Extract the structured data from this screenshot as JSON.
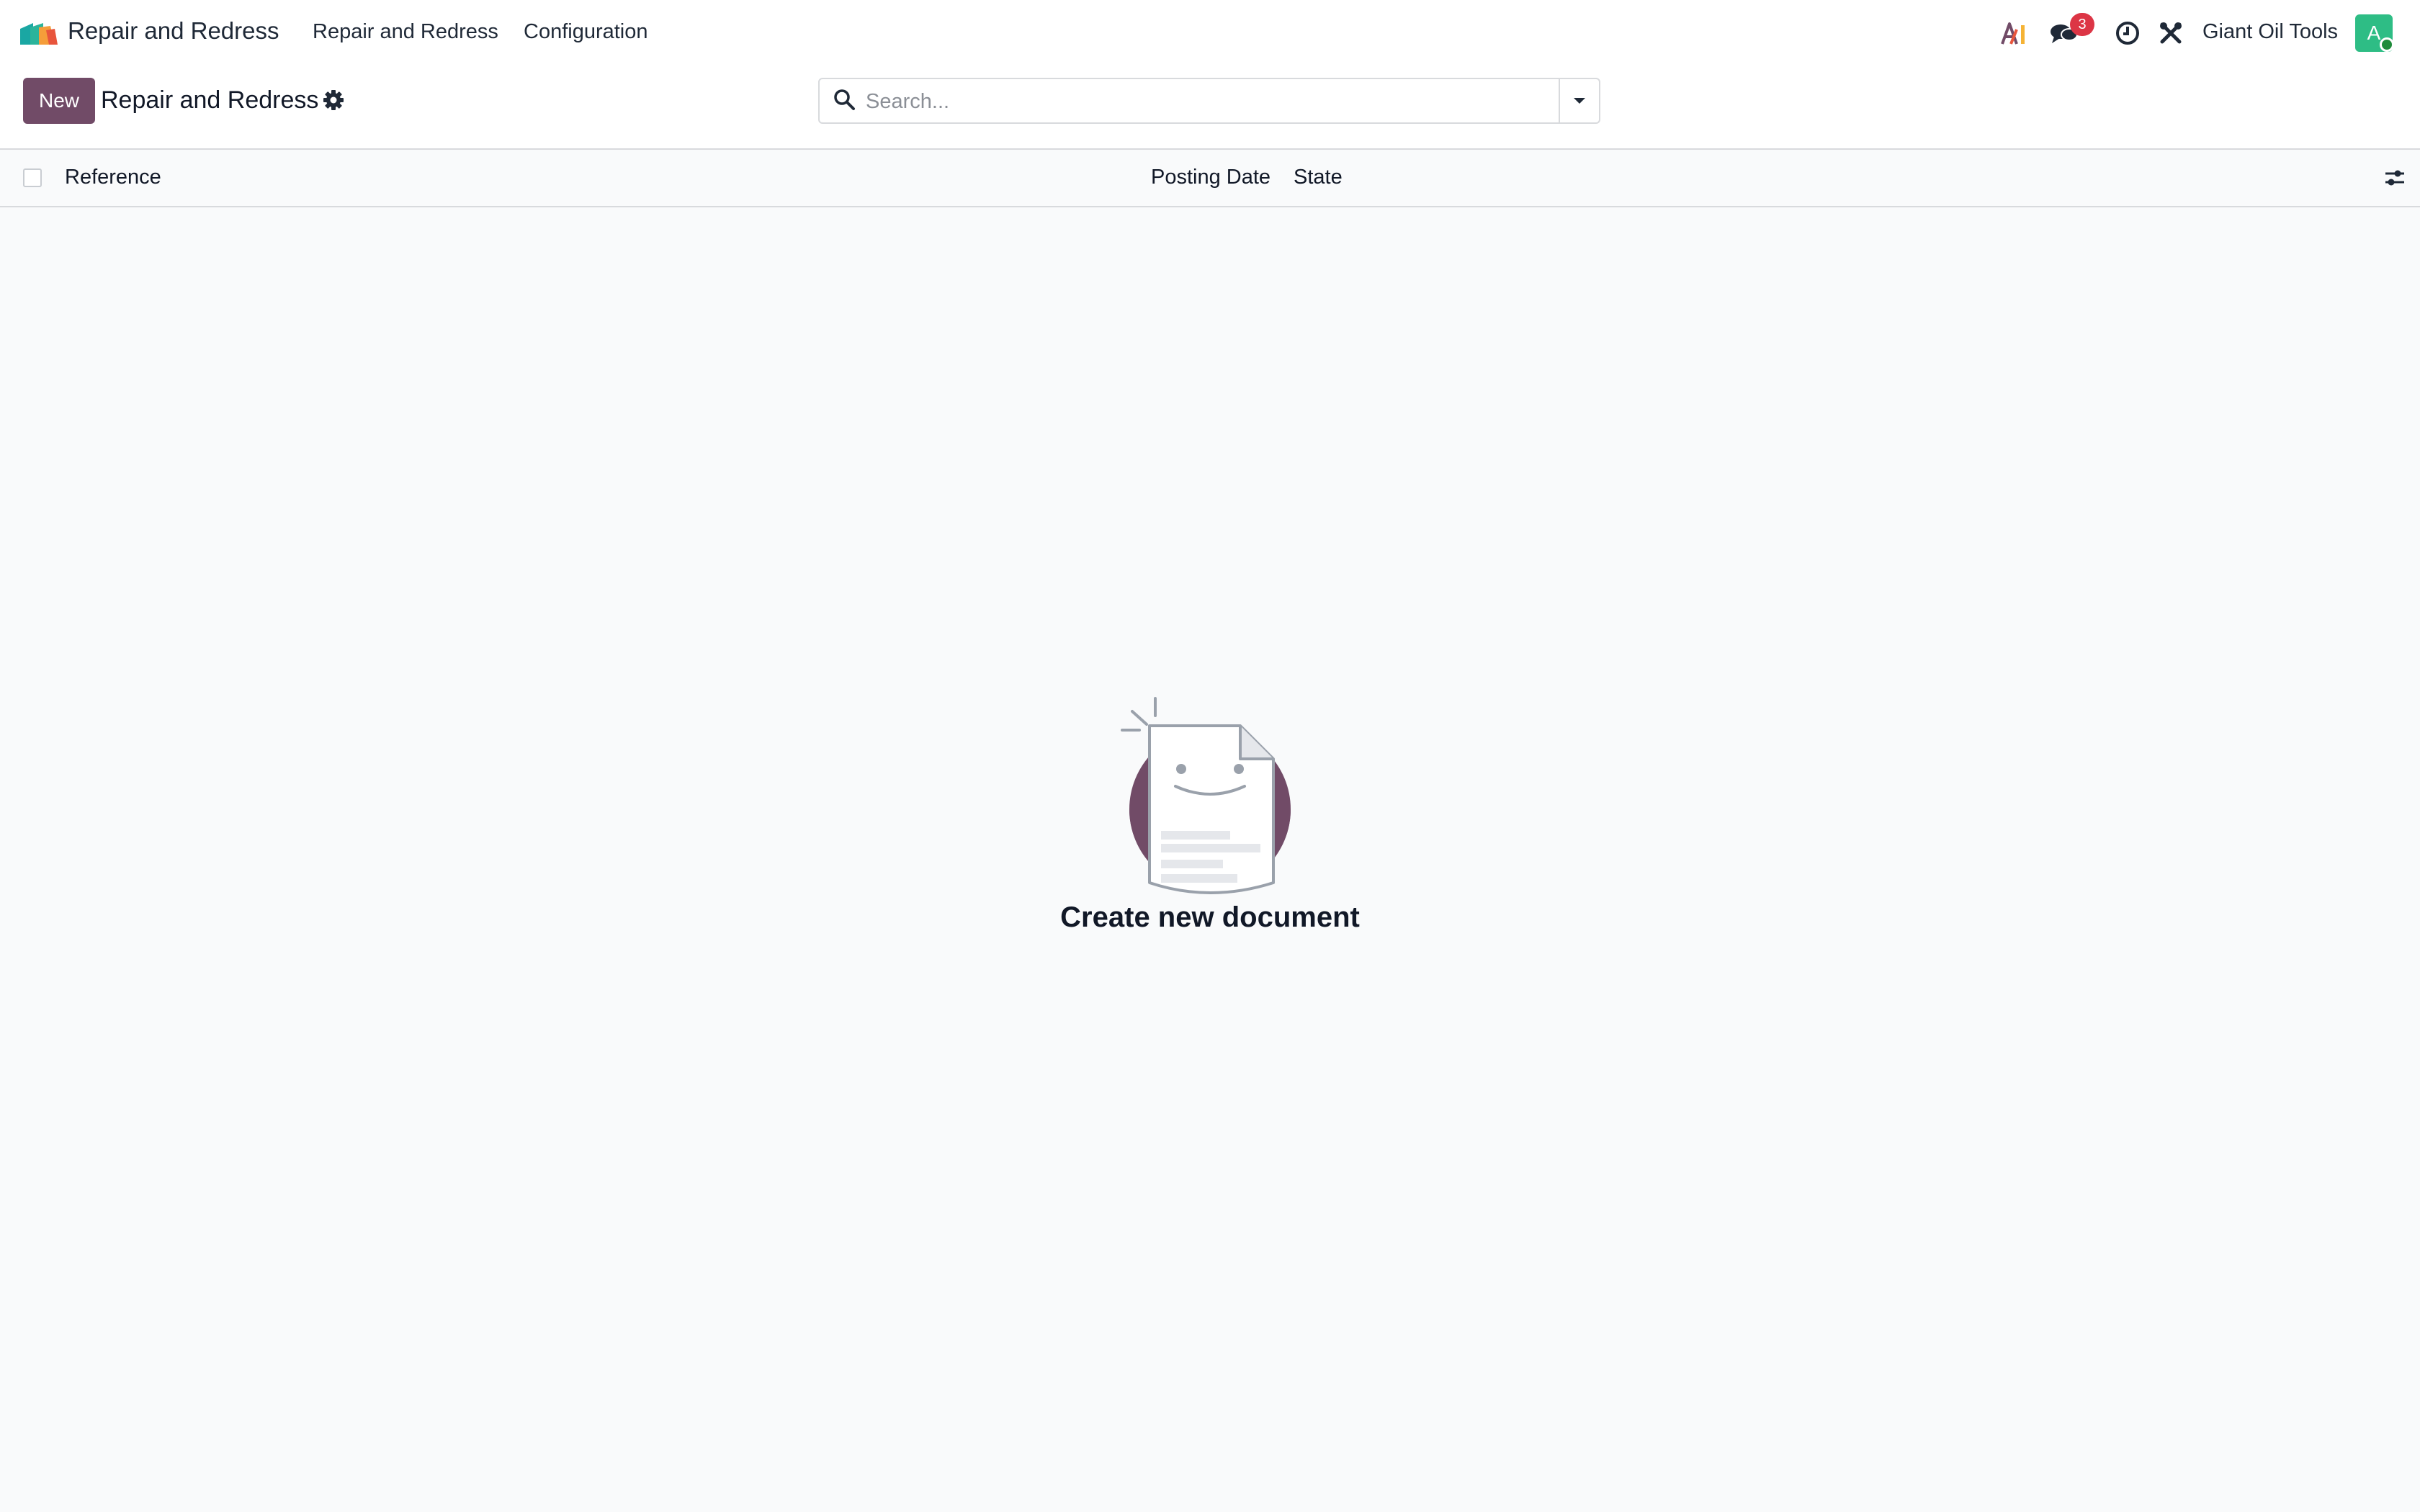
{
  "navbar": {
    "app_name": "Repair and Redress",
    "menu": [
      "Repair and Redress",
      "Configuration"
    ],
    "notification_count": "3",
    "company": "Giant Oil Tools",
    "avatar_initial": "A",
    "icons": [
      "ai-icon",
      "chat-icon",
      "clock-icon",
      "tools-icon"
    ]
  },
  "control_panel": {
    "new_label": "New",
    "breadcrumb": "Repair and Redress",
    "search_placeholder": "Search..."
  },
  "list": {
    "columns": [
      "Reference",
      "Posting Date",
      "State"
    ]
  },
  "empty_state": {
    "title": "Create new document"
  },
  "colors": {
    "primary": "#714b67",
    "badge": "#dc3545",
    "avatar": "#2ebd85",
    "online": "#1e8b3a"
  }
}
